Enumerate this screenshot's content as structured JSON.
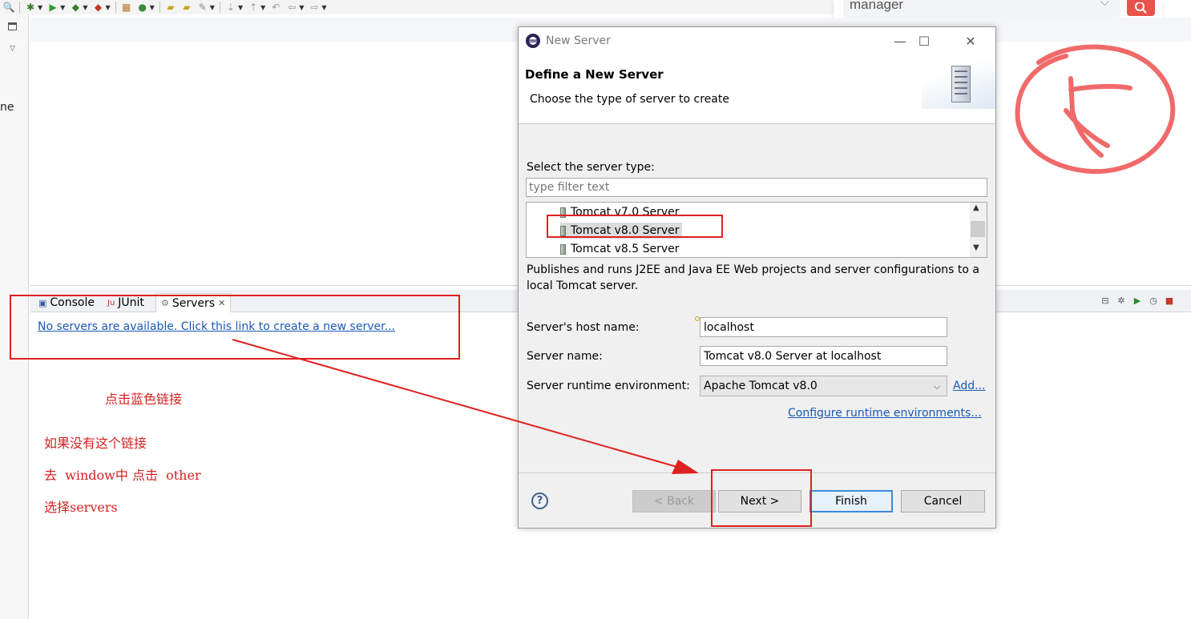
{
  "search": {
    "value": "manager"
  },
  "left_column": {
    "cut_text": "ne"
  },
  "views": {
    "tabs": [
      {
        "label": "Console"
      },
      {
        "label": "JUnit"
      },
      {
        "label": "Servers"
      }
    ],
    "servers_link": "No servers are available. Click this link to create a new server..."
  },
  "dialog": {
    "title": "New Server",
    "heading": "Define a New Server",
    "subheading": "Choose the type of server to create",
    "select_label": "Select the server type:",
    "filter_placeholder": "type filter text",
    "server_types": [
      {
        "label": "Tomcat v7.0 Server",
        "selected": false
      },
      {
        "label": "Tomcat v8.0 Server",
        "selected": true
      },
      {
        "label": "Tomcat v8.5 Server",
        "selected": false
      }
    ],
    "description": "Publishes and runs J2EE and Java EE Web projects and server configurations to a local Tomcat server.",
    "host_label": "Server's host name:",
    "host_value": "localhost",
    "name_label": "Server name:",
    "name_value": "Tomcat v8.0 Server at localhost",
    "runtime_label": "Server runtime environment:",
    "runtime_value": "Apache Tomcat v8.0",
    "add_link": "Add...",
    "configure_link": "Configure runtime environments...",
    "buttons": {
      "back": "< Back",
      "next": "Next >",
      "finish": "Finish",
      "cancel": "Cancel"
    }
  },
  "annotations": {
    "click_blue_link": "点击蓝色链接",
    "if_no_link": "如果没有这个链接",
    "go_window": "去  window中 点击  other",
    "select_servers": "选择servers"
  },
  "colors": {
    "annotation_red": "#e02020",
    "link_blue": "#1a59b5",
    "search_button": "#e8524a"
  }
}
